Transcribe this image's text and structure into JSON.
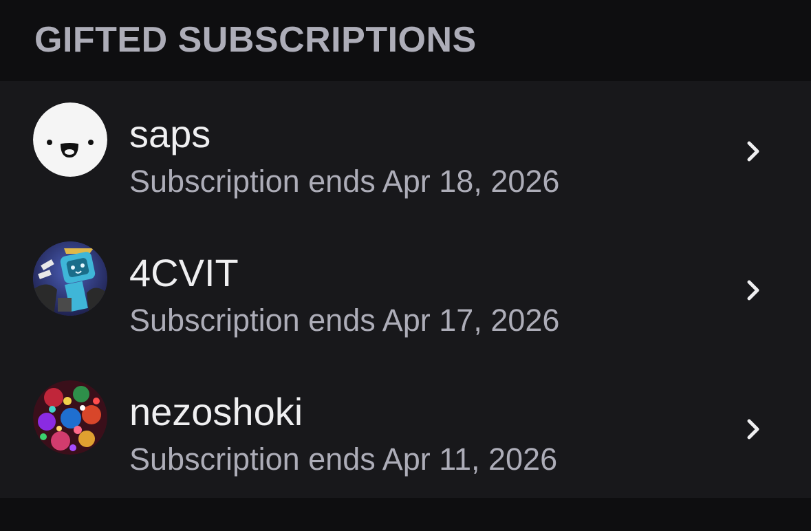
{
  "section": {
    "title": "GIFTED SUBSCRIPTIONS"
  },
  "subscriptions": [
    {
      "name": "saps",
      "subtitle": "Subscription ends Apr 18, 2026",
      "avatar_icon": "smiley-face-avatar"
    },
    {
      "name": "4CVIT",
      "subtitle": "Subscription ends Apr 17, 2026",
      "avatar_icon": "robot-avatar"
    },
    {
      "name": "nezoshoki",
      "subtitle": "Subscription ends Apr 11, 2026",
      "avatar_icon": "colorful-pattern-avatar"
    }
  ],
  "colors": {
    "background": "#0e0e10",
    "list_background": "#18181b",
    "primary_text": "#efeff1",
    "secondary_text": "#adadb8"
  },
  "icons": {
    "row_action": "chevron-right-icon"
  }
}
